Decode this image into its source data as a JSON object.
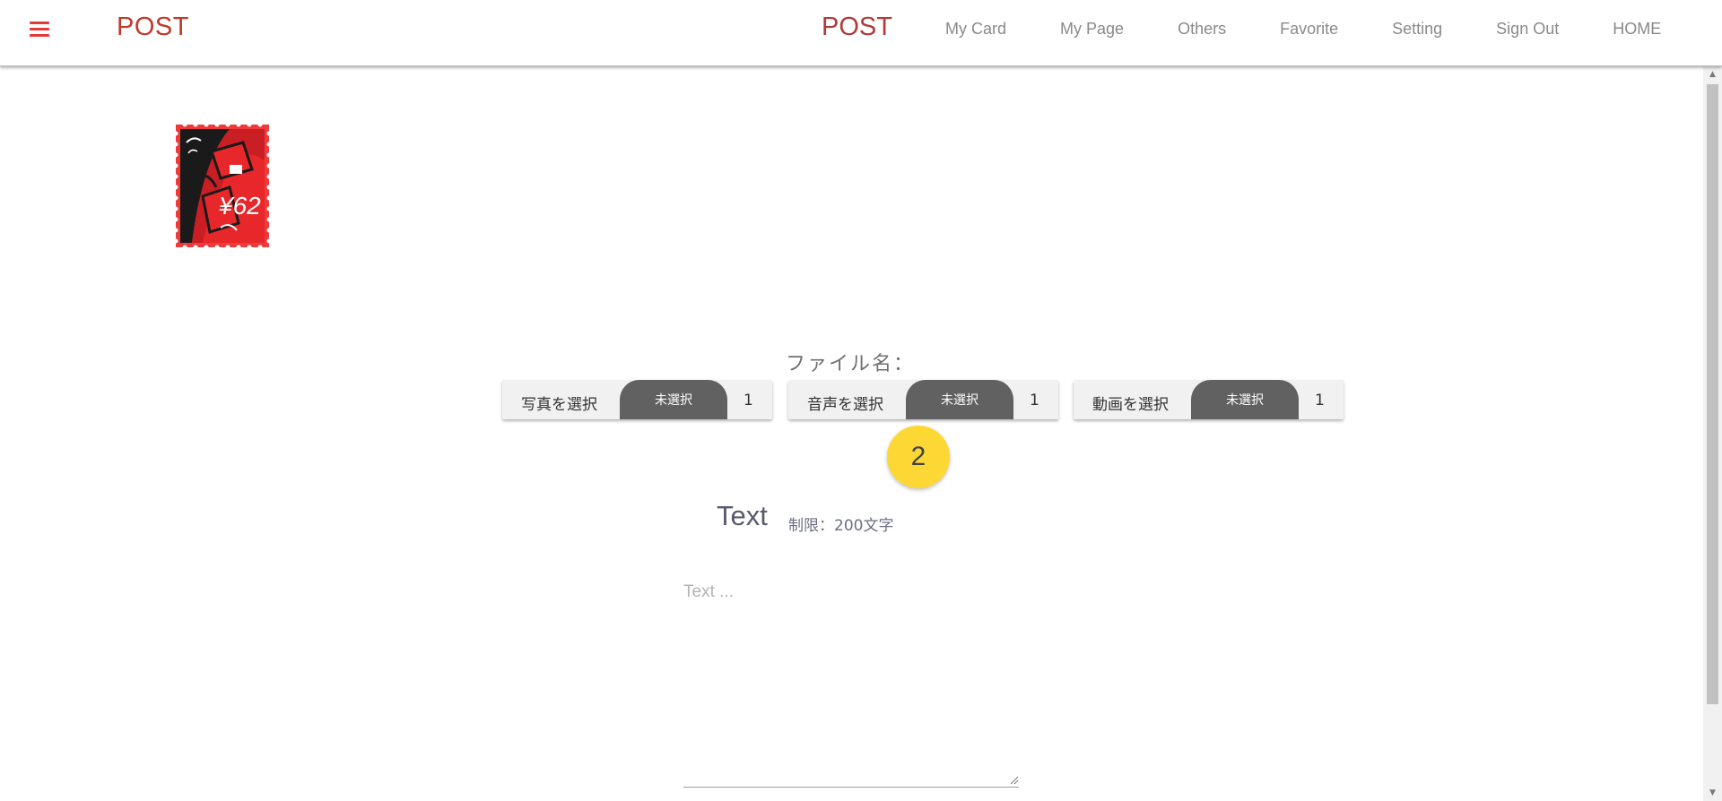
{
  "navbar": {
    "brand": "POST",
    "center_title": "POST",
    "links": [
      "My Card",
      "My Page",
      "Others",
      "Favorite",
      "Setting",
      "Sign Out",
      "HOME"
    ],
    "accent_color": "#e53935"
  },
  "stamp": {
    "text": "¥62",
    "color": "#f03a3a"
  },
  "upload": {
    "filename_label": "ファイル名：",
    "buttons": [
      {
        "label": "写真を選択",
        "status": "未選択",
        "count": "1"
      },
      {
        "label": "音声を選択",
        "status": "未選択",
        "count": "1"
      },
      {
        "label": "動画を選択",
        "status": "未選択",
        "count": "1"
      }
    ]
  },
  "badge": {
    "value": "2",
    "color": "#fdd835"
  },
  "text_section": {
    "heading": "Text",
    "limit": "制限：200文字",
    "placeholder": "Text ..."
  }
}
